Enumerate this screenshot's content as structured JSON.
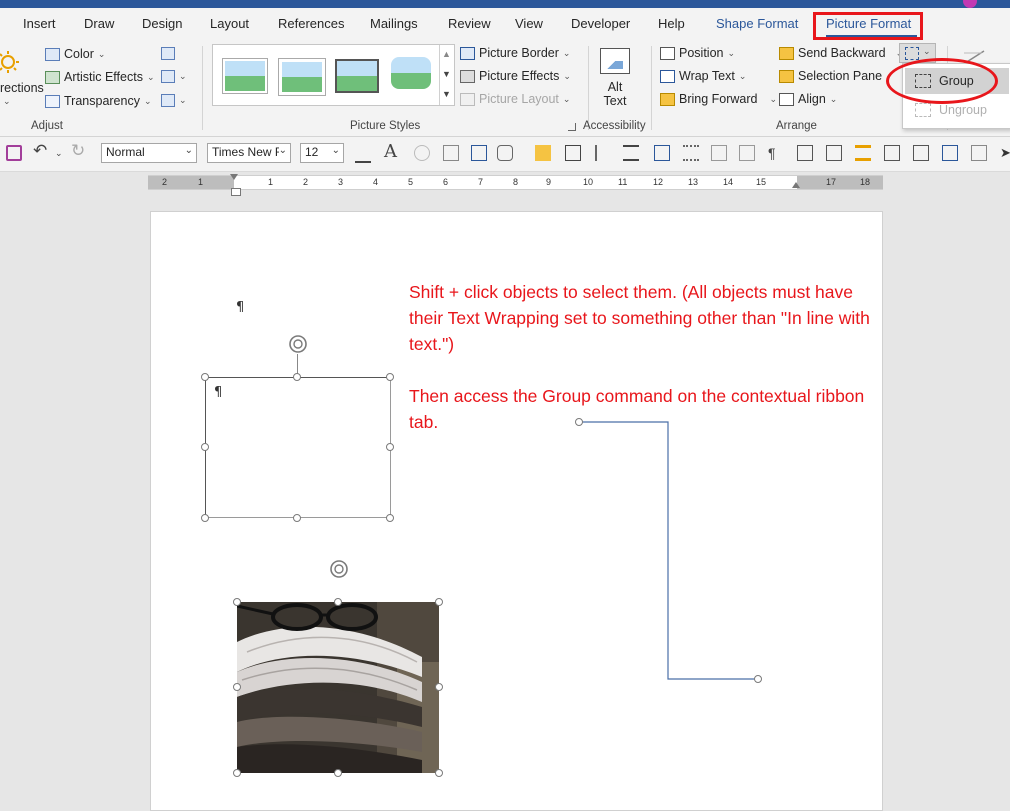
{
  "tabs": [
    "Insert",
    "Draw",
    "Design",
    "Layout",
    "References",
    "Mailings",
    "Review",
    "View",
    "Developer",
    "Help",
    "Shape Format",
    "Picture Format"
  ],
  "active_tab": "Picture Format",
  "adjust": {
    "corrections": "rections",
    "color": "Color",
    "artistic_effects": "Artistic Effects",
    "transparency": "Transparency",
    "label": "Adjust"
  },
  "picture_styles": {
    "border": "Picture Border",
    "effects": "Picture Effects",
    "layout": "Picture Layout",
    "label": "Picture Styles"
  },
  "accessibility": {
    "alt_line1": "Alt",
    "alt_line2": "Text",
    "label": "Accessibility"
  },
  "arrange": {
    "position": "Position",
    "wrap_text": "Wrap Text",
    "bring_forward": "Bring Forward",
    "send_backward": "Send Backward",
    "selection_pane": "Selection Pane",
    "align": "Align",
    "label": "Arrange"
  },
  "group_menu": {
    "group": "Group",
    "ungroup": "Ungroup"
  },
  "toolbar": {
    "style_value": "Normal",
    "font_value": "Times New R",
    "size_value": "12"
  },
  "ruler": {
    "numbers": [
      "2",
      "1",
      "1",
      "2",
      "3",
      "4",
      "5",
      "6",
      "7",
      "8",
      "9",
      "10",
      "11",
      "12",
      "13",
      "14",
      "15",
      "17",
      "18"
    ]
  },
  "document": {
    "pilcrow": "¶",
    "instruction1": "Shift + click objects to select them. (All objects must have their Text Wrapping set to something other than \"In line with text.\")",
    "instruction2": "Then access the Group command on the contextual ribbon tab."
  },
  "colors": {
    "accent": "#2b579a",
    "highlight_red": "#e8161b",
    "connector_blue": "#4a6fa8"
  }
}
